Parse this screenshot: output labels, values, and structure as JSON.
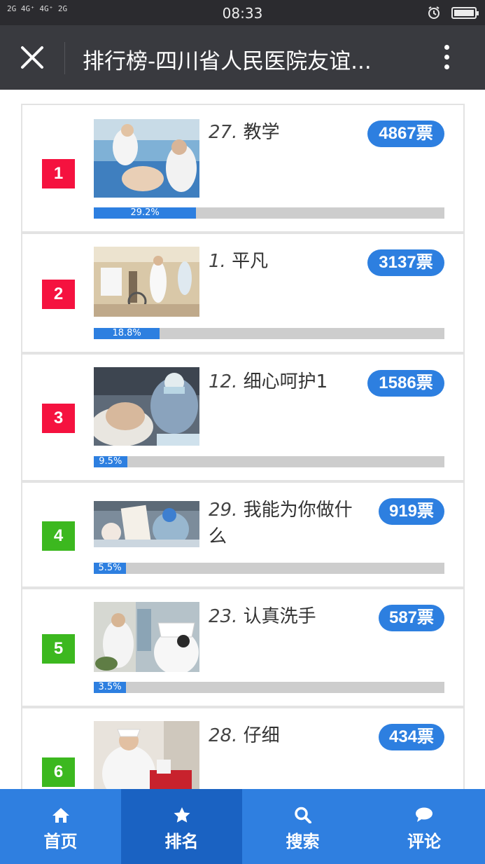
{
  "status_bar": {
    "signal": "2G 4G⁺ 4G⁺ 2G",
    "time": "08:33"
  },
  "header": {
    "title": "排行榜-四川省人民医院友谊..."
  },
  "ranking": [
    {
      "rank": "1",
      "number": "27.",
      "name": "教学",
      "votes": "4867票",
      "percent": "29.2%",
      "percent_value": 29.2
    },
    {
      "rank": "2",
      "number": "1.",
      "name": "平凡",
      "votes": "3137票",
      "percent": "18.8%",
      "percent_value": 18.8
    },
    {
      "rank": "3",
      "number": "12.",
      "name": "细心呵护1",
      "votes": "1586票",
      "percent": "9.5%",
      "percent_value": 9.5
    },
    {
      "rank": "4",
      "number": "29.",
      "name": "我能为你做什么",
      "votes": "919票",
      "percent": "5.5%",
      "percent_value": 5.5
    },
    {
      "rank": "5",
      "number": "23.",
      "name": "认真洗手",
      "votes": "587票",
      "percent": "3.5%",
      "percent_value": 3.5
    },
    {
      "rank": "6",
      "number": "28.",
      "name": "仔细",
      "votes": "434票"
    }
  ],
  "nav": [
    {
      "label": "首页",
      "icon": "home-icon"
    },
    {
      "label": "排名",
      "icon": "star-icon"
    },
    {
      "label": "搜索",
      "icon": "search-icon"
    },
    {
      "label": "评论",
      "icon": "comment-icon"
    }
  ],
  "colors": {
    "top_rank": "#f5123f",
    "other_rank": "#3cb81f",
    "accent": "#2d7fe0",
    "nav_active": "#1a62c2"
  }
}
